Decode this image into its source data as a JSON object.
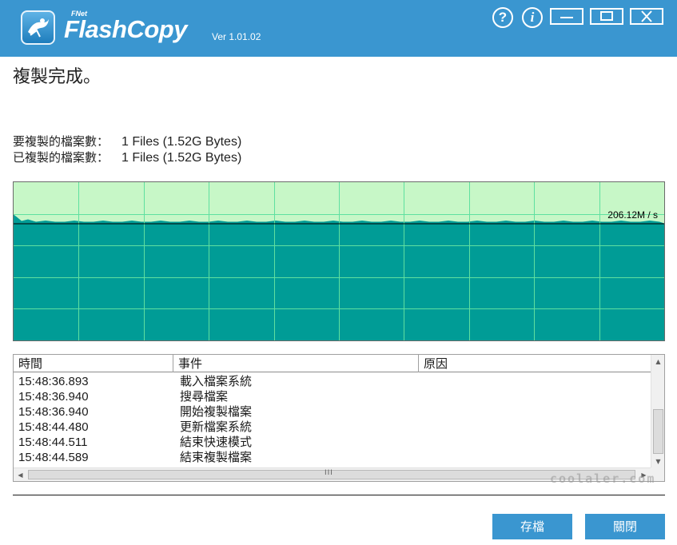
{
  "app": {
    "brand_small": "FNet",
    "name": "FlashCopy",
    "version": "Ver 1.01.02"
  },
  "titlebar": {
    "help_glyph": "?",
    "info_glyph": "i"
  },
  "status": {
    "message": "複製完成。"
  },
  "summary": {
    "to_copy_label": "要複製的檔案數：",
    "to_copy_value": "1 Files (1.52G Bytes)",
    "copied_label": "已複製的檔案數：",
    "copied_value": "1 Files (1.52G Bytes)"
  },
  "chart_data": {
    "type": "area",
    "current_speed_label": "206.12M / s",
    "fill_level": 0.74,
    "colors": {
      "background": "#c7f7c7",
      "fill": "#009c96",
      "grid": "#5fe0a0"
    }
  },
  "log": {
    "columns": [
      "時間",
      "事件",
      "原因"
    ],
    "rows": [
      {
        "time": "15:48:36.893",
        "event": "載入檔案系統",
        "reason": ""
      },
      {
        "time": "15:48:36.940",
        "event": "搜尋檔案",
        "reason": ""
      },
      {
        "time": "15:48:36.940",
        "event": "開始複製檔案",
        "reason": ""
      },
      {
        "time": "15:48:44.480",
        "event": "更新檔案系統",
        "reason": ""
      },
      {
        "time": "15:48:44.511",
        "event": "結束快速模式",
        "reason": ""
      },
      {
        "time": "15:48:44.589",
        "event": "結束複製檔案",
        "reason": ""
      }
    ]
  },
  "buttons": {
    "save": "存檔",
    "close": "關閉"
  },
  "watermark": "coolaler.com"
}
